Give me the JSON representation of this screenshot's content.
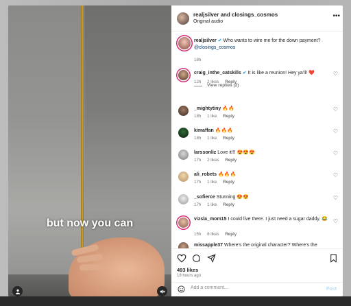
{
  "header": {
    "title": "realjsilver and closings_cosmos",
    "subtitle": "Original audio",
    "more_icon": "more-horizontal-icon"
  },
  "video": {
    "caption": "but now you can",
    "user_icon": "user-icon",
    "mute_icon": "mute-icon"
  },
  "caption_comment": {
    "username": "realjsilver",
    "text": "Who wants to wire me for the down payment?",
    "mention": "@closings_cosmos",
    "time": "18h"
  },
  "comments": [
    {
      "username": "craig_inthe_catskills",
      "verified": true,
      "text": "It is like a reunion! Hey ya'll! ❤️",
      "time": "12h",
      "likes": "2 likes",
      "reply": "Reply",
      "view_replies": "View replies (2)"
    },
    {
      "username": "_mightytiny",
      "verified": false,
      "text": "🔥🔥",
      "time": "18h",
      "likes": "1 like",
      "reply": "Reply"
    },
    {
      "username": "kimaffan",
      "verified": false,
      "text": "🔥🔥🔥",
      "time": "18h",
      "likes": "1 like",
      "reply": "Reply"
    },
    {
      "username": "larssonliz",
      "verified": false,
      "text": "Love it!!! 😍😍😍",
      "time": "17h",
      "likes": "2 likes",
      "reply": "Reply"
    },
    {
      "username": "ali_robets",
      "verified": false,
      "text": "🔥🔥🔥",
      "time": "17h",
      "likes": "1 like",
      "reply": "Reply"
    },
    {
      "username": "_sofierce",
      "verified": false,
      "text": "Stunning 😍😍",
      "time": "17h",
      "likes": "1 like",
      "reply": "Reply"
    },
    {
      "username": "vizsla_mom15",
      "verified": false,
      "text": "I could live there. I just need a sugar daddy. 😂",
      "time": "15h",
      "likes": "6 likes",
      "reply": "Reply"
    },
    {
      "username": "missapple37",
      "verified": false,
      "text": "Where's the original character? Where's the",
      "time": "",
      "likes": "",
      "reply": ""
    }
  ],
  "actions": {
    "like_icon": "heart-icon",
    "comment_icon": "comment-icon",
    "share_icon": "share-icon",
    "save_icon": "bookmark-icon"
  },
  "likes_count": "493 likes",
  "posted_time": "18 hours ago",
  "add_comment": {
    "placeholder": "Add a comment...",
    "post_label": "Post",
    "emoji_icon": "emoji-icon"
  },
  "colors": {
    "link": "#00376b",
    "verified": "#0095f6",
    "post_disabled": "#b2dffc",
    "story_ring": "#d62976"
  }
}
